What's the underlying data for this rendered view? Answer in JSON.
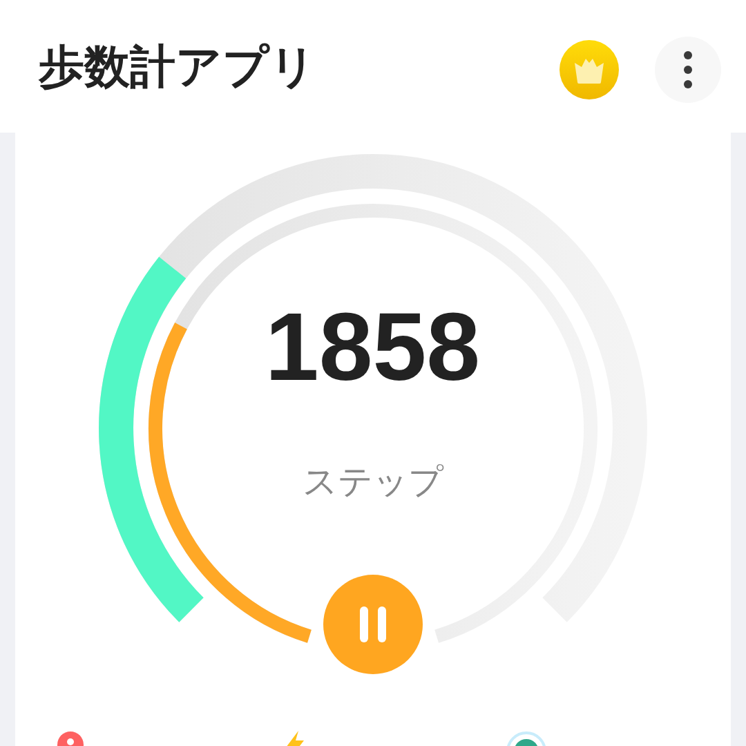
{
  "app_bar": {
    "title": "歩数計アプリ"
  },
  "gauge": {
    "count": "1858",
    "unit": "ステップ",
    "running": true
  }
}
